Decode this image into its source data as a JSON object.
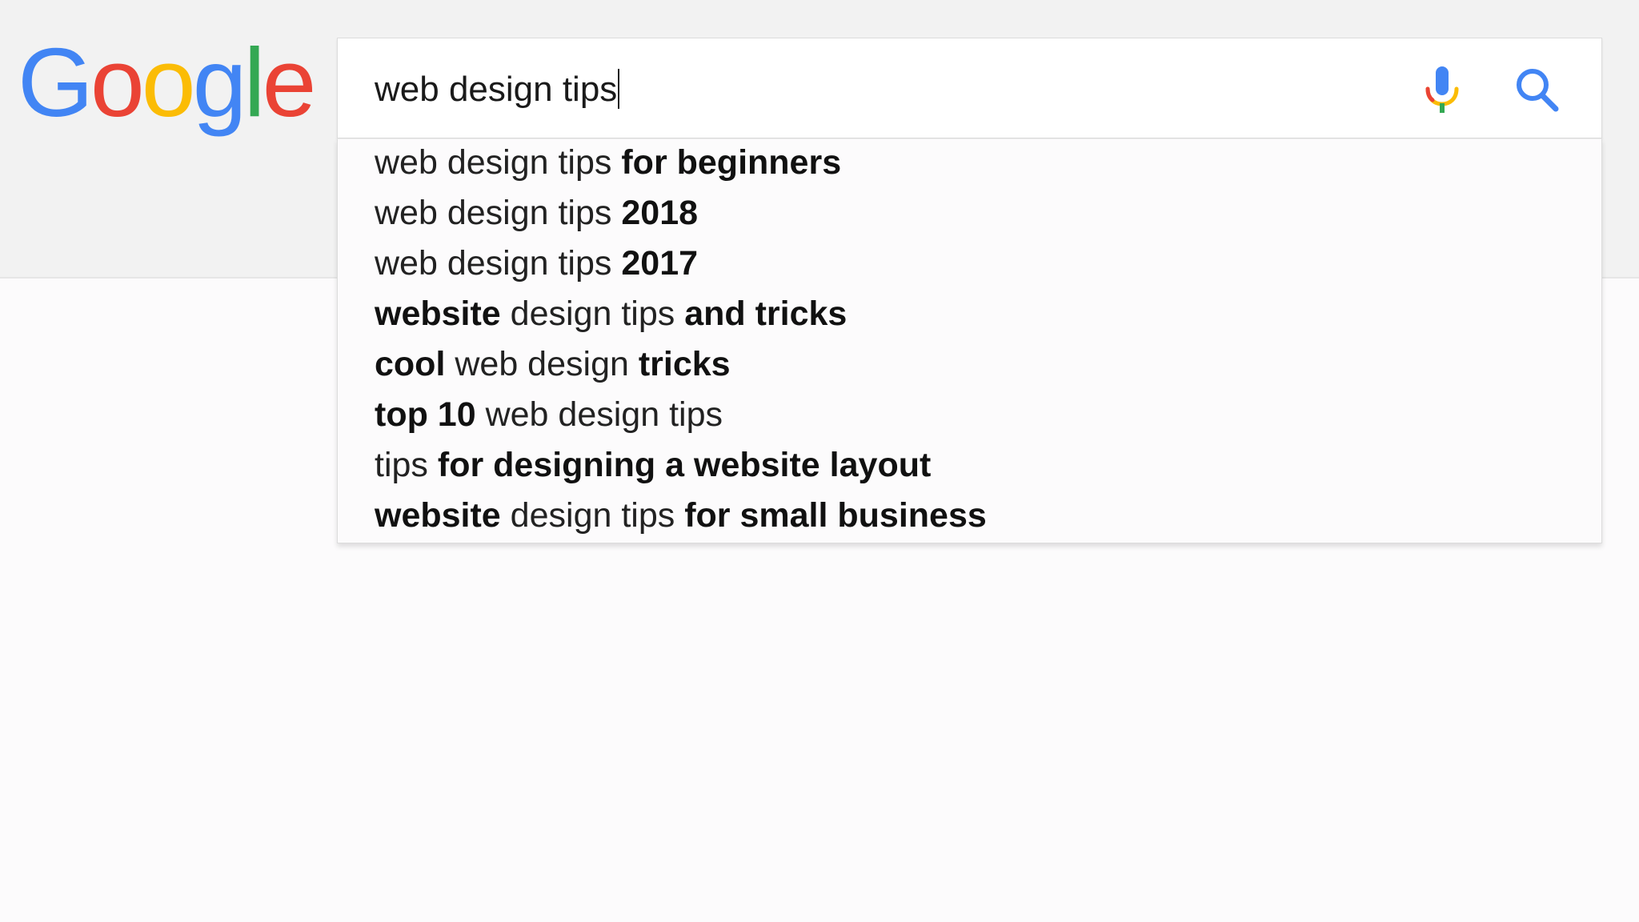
{
  "logo": {
    "letters": [
      {
        "char": "G",
        "color": "#4285f4"
      },
      {
        "char": "o",
        "color": "#ea4335"
      },
      {
        "char": "o",
        "color": "#fbbc05"
      },
      {
        "char": "g",
        "color": "#4285f4"
      },
      {
        "char": "l",
        "color": "#34a853"
      },
      {
        "char": "e",
        "color": "#ea4335"
      }
    ]
  },
  "search": {
    "query": "web design tips",
    "mic_icon": "microphone-icon",
    "search_icon": "magnifier-icon",
    "search_icon_color": "#4285f4"
  },
  "suggestions": [
    {
      "parts": [
        {
          "text": "web design tips ",
          "bold": false
        },
        {
          "text": "for beginners",
          "bold": true
        }
      ]
    },
    {
      "parts": [
        {
          "text": "web design tips ",
          "bold": false
        },
        {
          "text": "2018",
          "bold": true
        }
      ]
    },
    {
      "parts": [
        {
          "text": "web design tips ",
          "bold": false
        },
        {
          "text": "2017",
          "bold": true
        }
      ]
    },
    {
      "parts": [
        {
          "text": "website",
          "bold": true
        },
        {
          "text": " design tips ",
          "bold": false
        },
        {
          "text": "and tricks",
          "bold": true
        }
      ]
    },
    {
      "parts": [
        {
          "text": "cool",
          "bold": true
        },
        {
          "text": " web design ",
          "bold": false
        },
        {
          "text": "tricks",
          "bold": true
        }
      ]
    },
    {
      "parts": [
        {
          "text": "top 10",
          "bold": true
        },
        {
          "text": " web design tips",
          "bold": false
        }
      ]
    },
    {
      "parts": [
        {
          "text": "tips ",
          "bold": false
        },
        {
          "text": "for designing a website layout",
          "bold": true
        }
      ]
    },
    {
      "parts": [
        {
          "text": "website",
          "bold": true
        },
        {
          "text": " design tips ",
          "bold": false
        },
        {
          "text": "for small business",
          "bold": true
        }
      ]
    }
  ]
}
